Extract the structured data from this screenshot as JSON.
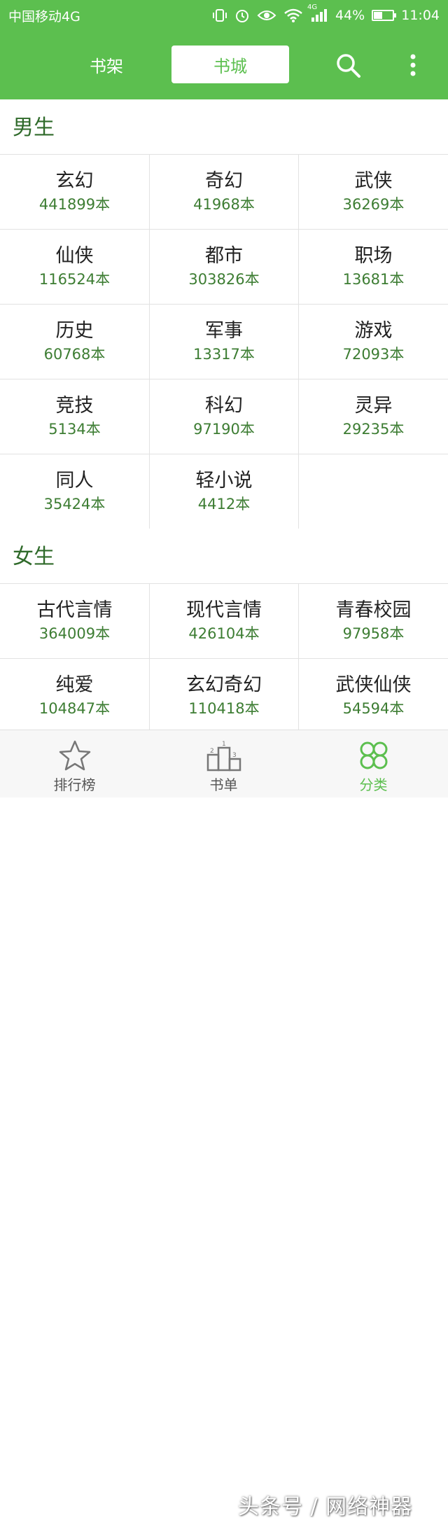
{
  "status_bar": {
    "carrier": "中国移动4G",
    "network_badge": "4G",
    "battery_level": 44,
    "battery_text": "44%",
    "time": "11:04"
  },
  "header": {
    "tab_shelf": "书架",
    "tab_store": "书城"
  },
  "sections": {
    "male": {
      "title": "男生",
      "items": [
        {
          "name": "玄幻",
          "count": "441899本"
        },
        {
          "name": "奇幻",
          "count": "41968本"
        },
        {
          "name": "武侠",
          "count": "36269本"
        },
        {
          "name": "仙侠",
          "count": "116524本"
        },
        {
          "name": "都市",
          "count": "303826本"
        },
        {
          "name": "职场",
          "count": "13681本"
        },
        {
          "name": "历史",
          "count": "60768本"
        },
        {
          "name": "军事",
          "count": "13317本"
        },
        {
          "name": "游戏",
          "count": "72093本"
        },
        {
          "name": "竞技",
          "count": "5134本"
        },
        {
          "name": "科幻",
          "count": "97190本"
        },
        {
          "name": "灵异",
          "count": "29235本"
        },
        {
          "name": "同人",
          "count": "35424本"
        },
        {
          "name": "轻小说",
          "count": "4412本"
        }
      ]
    },
    "female": {
      "title": "女生",
      "items": [
        {
          "name": "古代言情",
          "count": "364009本"
        },
        {
          "name": "现代言情",
          "count": "426104本"
        },
        {
          "name": "青春校园",
          "count": "97958本"
        },
        {
          "name": "纯爱",
          "count": "104847本"
        },
        {
          "name": "玄幻奇幻",
          "count": "110418本"
        },
        {
          "name": "武侠仙侠",
          "count": "54594本"
        }
      ]
    }
  },
  "bottom_nav": {
    "ranking": "排行榜",
    "booklist": "书单",
    "category": "分类"
  },
  "watermark": "头条号 / 网络神器",
  "colors": {
    "brand_green": "#5cbf4f",
    "section_title": "#2f6a2a",
    "count_green": "#3d7d33"
  }
}
